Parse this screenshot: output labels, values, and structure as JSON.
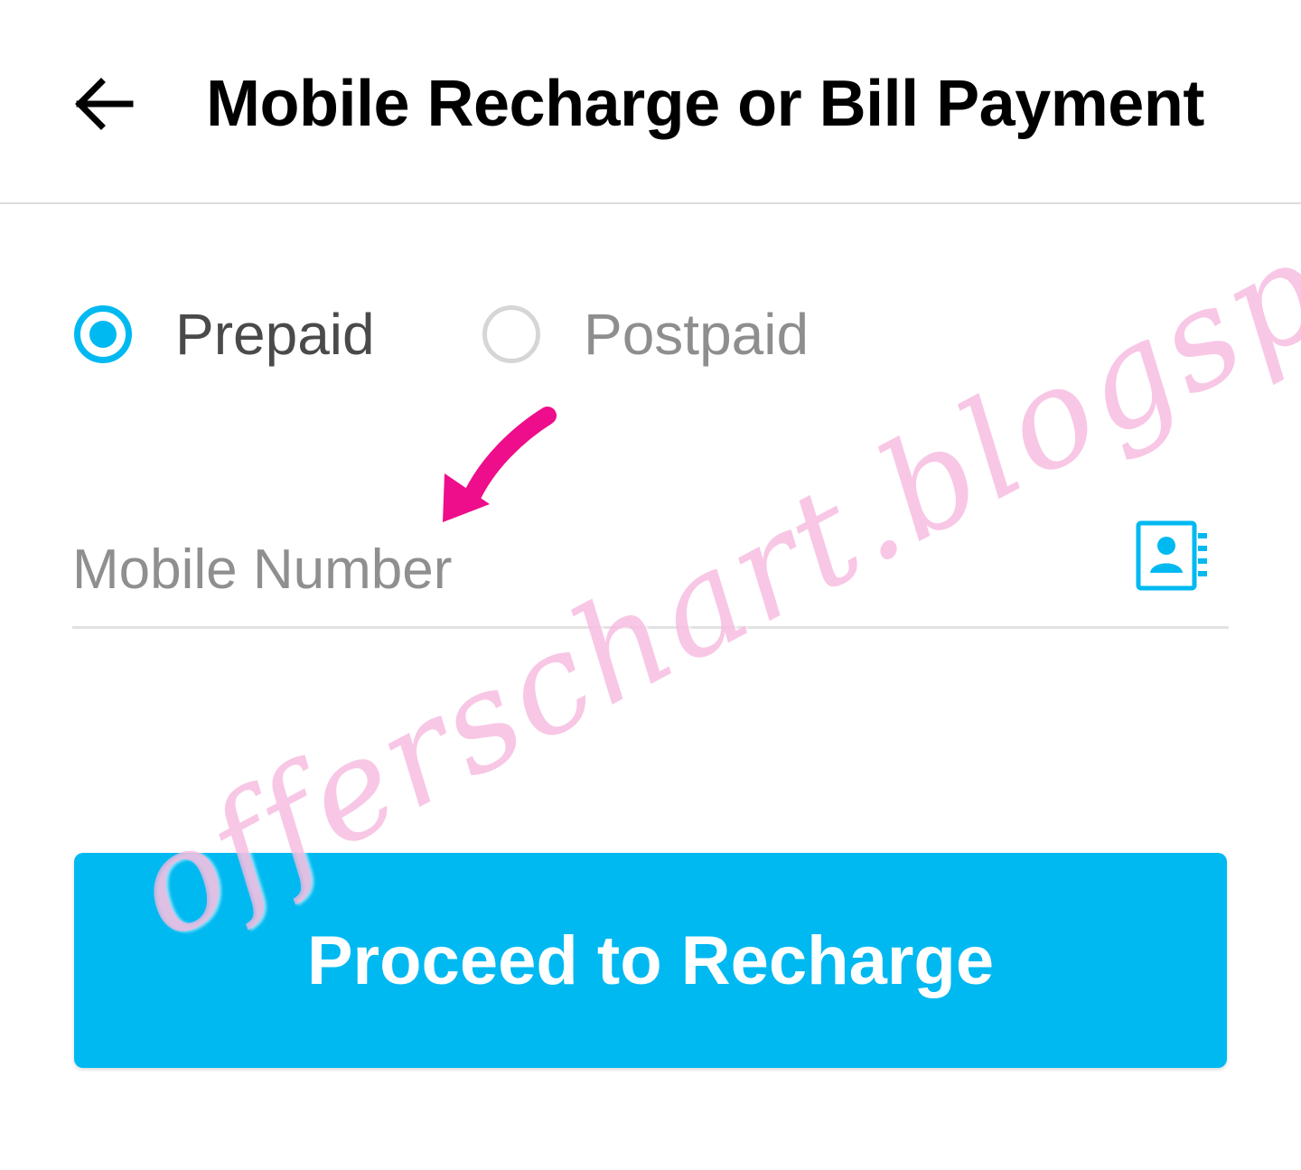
{
  "header": {
    "back_icon": "arrow-left-icon",
    "title": "Mobile Recharge or Bill Payment"
  },
  "recharge_type": {
    "options": [
      {
        "label": "Prepaid",
        "selected": true
      },
      {
        "label": "Postpaid",
        "selected": false
      }
    ]
  },
  "mobile_field": {
    "placeholder": "Mobile Number",
    "value": "",
    "contact_icon": "contact-book-icon"
  },
  "proceed_button": {
    "label": "Proceed to Recharge"
  },
  "annotation": {
    "icon": "pointer-arrow-icon",
    "color": "#ee0d8a"
  },
  "watermark": {
    "text": "offerschart.blogspot"
  },
  "colors": {
    "accent": "#00b9f1",
    "annotation": "#ee0d8a"
  }
}
